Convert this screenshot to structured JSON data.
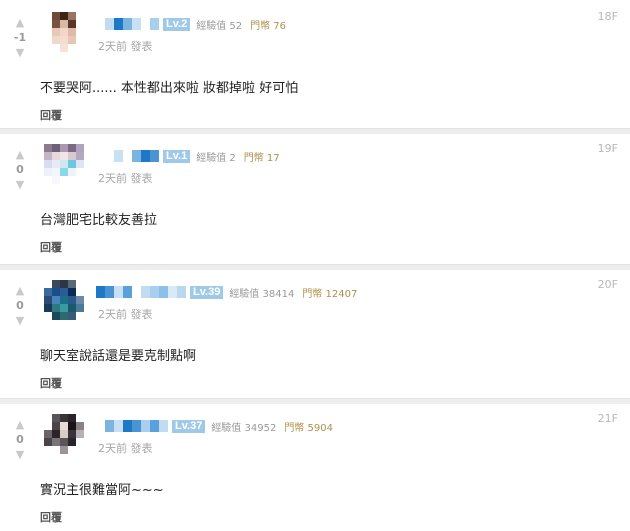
{
  "comments": [
    {
      "score": "-1",
      "level": "Lv.2",
      "exp": "經驗值 52",
      "coins": "門幣 76",
      "time": "2天前 發表",
      "floor": "18F",
      "content": "不要哭阿...... 本性都出來啦 妝都掉啦 好可怕",
      "reply": "回覆",
      "avatar_colors": [
        "#ffffff",
        "#6b4a3a",
        "#3c2418",
        "#9a7260",
        "#ffffff",
        "#ffffff",
        "#7a5240",
        "#d9b8a8",
        "#5a3426",
        "#ffffff",
        "#ffffff",
        "#e8c8b8",
        "#f2d6c8",
        "#e0b8a8",
        "#ffffff",
        "#ffffff",
        "#f0d8cc",
        "#f4dcd0",
        "#e8c6b6",
        "#ffffff",
        "#ffffff",
        "#ffffff",
        "#f6e2d8",
        "#ffffff",
        "#ffffff"
      ],
      "name_colors": [
        "#ffffff",
        "#c0dcf0",
        "#1e78c8",
        "#7ab4e0",
        "#c8e0f4",
        "#ffffff",
        "#a8d0ee"
      ]
    },
    {
      "score": "0",
      "level": "Lv.1",
      "exp": "經驗值 2",
      "coins": "門幣 17",
      "time": "2天前 發表",
      "floor": "19F",
      "content": "台灣肥宅比較友善拉",
      "reply": "回覆",
      "avatar_colors": [
        "#8a7a8e",
        "#6e6078",
        "#a898b0",
        "#7c6a84",
        "#b0a4bc",
        "#c4b4c4",
        "#e8d8dc",
        "#f0e4e8",
        "#d8c8d0",
        "#b4a8c0",
        "#d8dcf0",
        "#e8eaf6",
        "#cfe8f0",
        "#6ac8e0",
        "#e0e4f4",
        "#eef0fa",
        "#f4f6fc",
        "#8ad8ea",
        "#f0f2fa",
        "#ffffff",
        "#ffffff",
        "#f6f8fc",
        "#ffffff",
        "#ffffff",
        "#ffffff"
      ],
      "name_colors": [
        "#ffffff",
        "#ffffff",
        "#c8e0f4",
        "#ffffff",
        "#7ab4e0",
        "#1e78c8",
        "#4a94d4"
      ]
    },
    {
      "score": "0",
      "level": "Lv.39",
      "exp": "經驗值 38414",
      "coins": "門幣 12407",
      "time": "2天前 發表",
      "floor": "20F",
      "content": "聊天室說話還是要克制點啊",
      "reply": "回覆",
      "avatar_colors": [
        "#ffffff",
        "#3a4a5a",
        "#283848",
        "#5a6a74",
        "#ffffff",
        "#3a6aa0",
        "#1e4e8a",
        "#2a5c96",
        "#0a2c5a",
        "#ffffff",
        "#2c4c76",
        "#4a84c0",
        "#1a7088",
        "#2a5a8a",
        "#6a8aa8",
        "#1a3a5a",
        "#2a7a80",
        "#3a9aa0",
        "#1a5a6a",
        "#4a7a9a",
        "#ffffff",
        "#1a4a5a",
        "#2a6a70",
        "#3a5a7a",
        "#ffffff"
      ],
      "name_colors": [
        "#1e78c8",
        "#4a94d4",
        "#c8e0f4",
        "#5aa0dc",
        "#ffffff",
        "#c0dcf0",
        "#a8d0ee",
        "#8cc0e8",
        "#d8eaf6",
        "#b8d8f0"
      ]
    },
    {
      "score": "0",
      "level": "Lv.37",
      "exp": "經驗值 34952",
      "coins": "門幣 5904",
      "time": "2天前 發表",
      "floor": "21F",
      "content": "實況主很難當阿~~~",
      "reply": "回覆",
      "avatar_colors": [
        "#ffffff",
        "#5a5458",
        "#3a3438",
        "#2a2428",
        "#ffffff",
        "#ffffff",
        "#4a4448",
        "#e8dcd8",
        "#1a1418",
        "#8a8088",
        "#6a6468",
        "#2a2428",
        "#d8ccc8",
        "#3a3438",
        "#b8b0b4",
        "#4a4448",
        "#7a7478",
        "#5a5458",
        "#2a2428",
        "#ffffff",
        "#ffffff",
        "#ffffff",
        "#9a9498",
        "#ffffff",
        "#ffffff"
      ],
      "name_colors": [
        "#ffffff",
        "#7ab4e0",
        "#c8e0f4",
        "#1e78c8",
        "#4a94d4",
        "#a8d0ee",
        "#5aa0dc",
        "#c0dcf0"
      ]
    }
  ]
}
